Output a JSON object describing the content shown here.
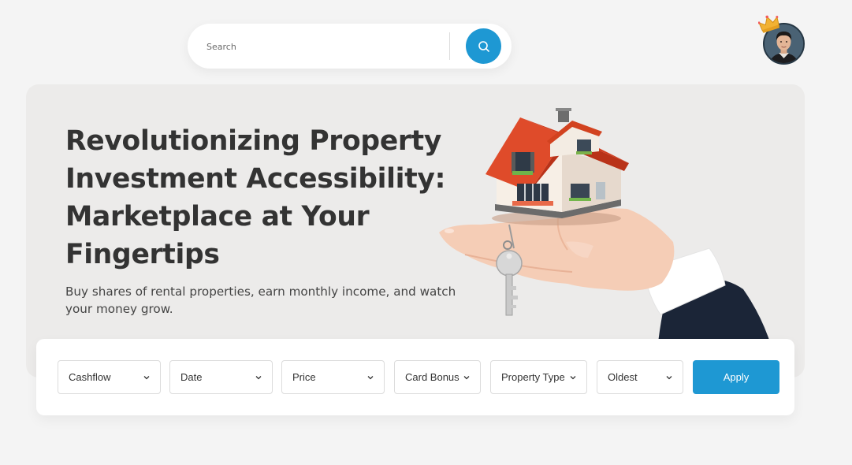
{
  "search": {
    "placeholder": "Search",
    "icon": "search-icon",
    "button_color": "#1e98d3"
  },
  "user": {
    "avatar_icon": "user-avatar",
    "badge_icon": "crown-icon"
  },
  "hero": {
    "title": "Revolutionizing Property Investment Accessibility: Marketplace at Your Fingertips",
    "subtitle": "Buy shares of rental properties, earn monthly income, and watch your money grow.",
    "illustration": "hand-holding-house-with-key-icon"
  },
  "filters": {
    "items": [
      {
        "label": "Cashflow"
      },
      {
        "label": "Date"
      },
      {
        "label": "Price"
      },
      {
        "label": "Card Bonus"
      },
      {
        "label": "Property Type"
      },
      {
        "label": "Oldest"
      }
    ],
    "apply_label": "Apply",
    "accent": "#1e98d3"
  }
}
